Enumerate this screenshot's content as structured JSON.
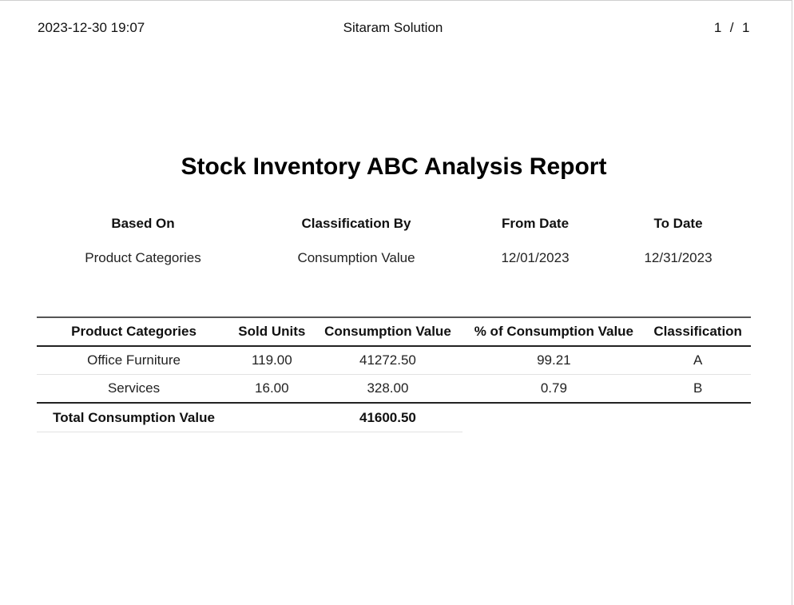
{
  "header": {
    "datetime": "2023-12-30 19:07",
    "company": "Sitaram Solution",
    "page_current": "1",
    "page_separator": "/",
    "page_total": "1"
  },
  "report": {
    "title": "Stock Inventory ABC Analysis Report"
  },
  "filters": {
    "based_on_label": "Based On",
    "based_on_value": "Product Categories",
    "classification_by_label": "Classification By",
    "classification_by_value": "Consumption Value",
    "from_date_label": "From Date",
    "from_date_value": "12/01/2023",
    "to_date_label": "To Date",
    "to_date_value": "12/31/2023"
  },
  "table": {
    "columns": [
      "Product Categories",
      "Sold Units",
      "Consumption Value",
      "% of Consumption Value",
      "Classification"
    ],
    "rows": [
      {
        "category": "Office Furniture",
        "sold_units": "119.00",
        "consumption_value": "41272.50",
        "pct_consumption_value": "99.21",
        "classification": "A"
      },
      {
        "category": "Services",
        "sold_units": "16.00",
        "consumption_value": "328.00",
        "pct_consumption_value": "0.79",
        "classification": "B"
      }
    ],
    "total": {
      "label": "Total Consumption Value",
      "value": "41600.50"
    }
  }
}
